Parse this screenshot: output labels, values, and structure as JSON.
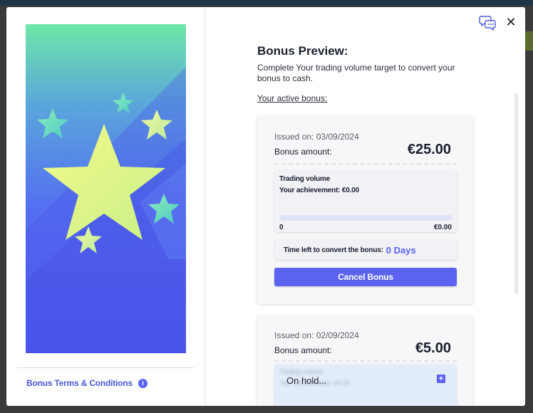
{
  "modal": {
    "close_icon": "close-icon",
    "chat_icon": "chat-bubbles-icon"
  },
  "left_panel": {
    "hero_icon": "stars-illustration",
    "terms_label": "Bonus Terms & Conditions",
    "info_badge": "i"
  },
  "right_panel": {
    "title": "Bonus Preview:",
    "description": "Complete Your trading volume target to convert your bonus to cash.",
    "active_link": "Your active bonus:"
  },
  "bonuses": [
    {
      "issued": "Issued on: 03/09/2024",
      "amount_label": "Bonus amount:",
      "amount": "€25.00",
      "trading_volume_label": "Trading volume",
      "achievement": "Your achievement: €0.00",
      "progress": 0,
      "progress_min": "0",
      "progress_max": "€0.00",
      "time_left_label": "Time left to convert the bonus:",
      "time_left_value": "0 Days",
      "cancel_label": "Cancel Bonus"
    },
    {
      "issued": "Issued on: 02/09/2024",
      "amount_label": "Bonus amount:",
      "amount": "€5.00",
      "trading_volume_label": "Trading volume",
      "achievement": "Your achievement: €0.00",
      "hold_label": "On hold...",
      "expand_symbol": "+"
    }
  ],
  "colors": {
    "accent": "#5b63f0",
    "link": "#4b57d9",
    "card_bg": "#f7f7f9",
    "hold_bg": "#e3ecfb"
  }
}
